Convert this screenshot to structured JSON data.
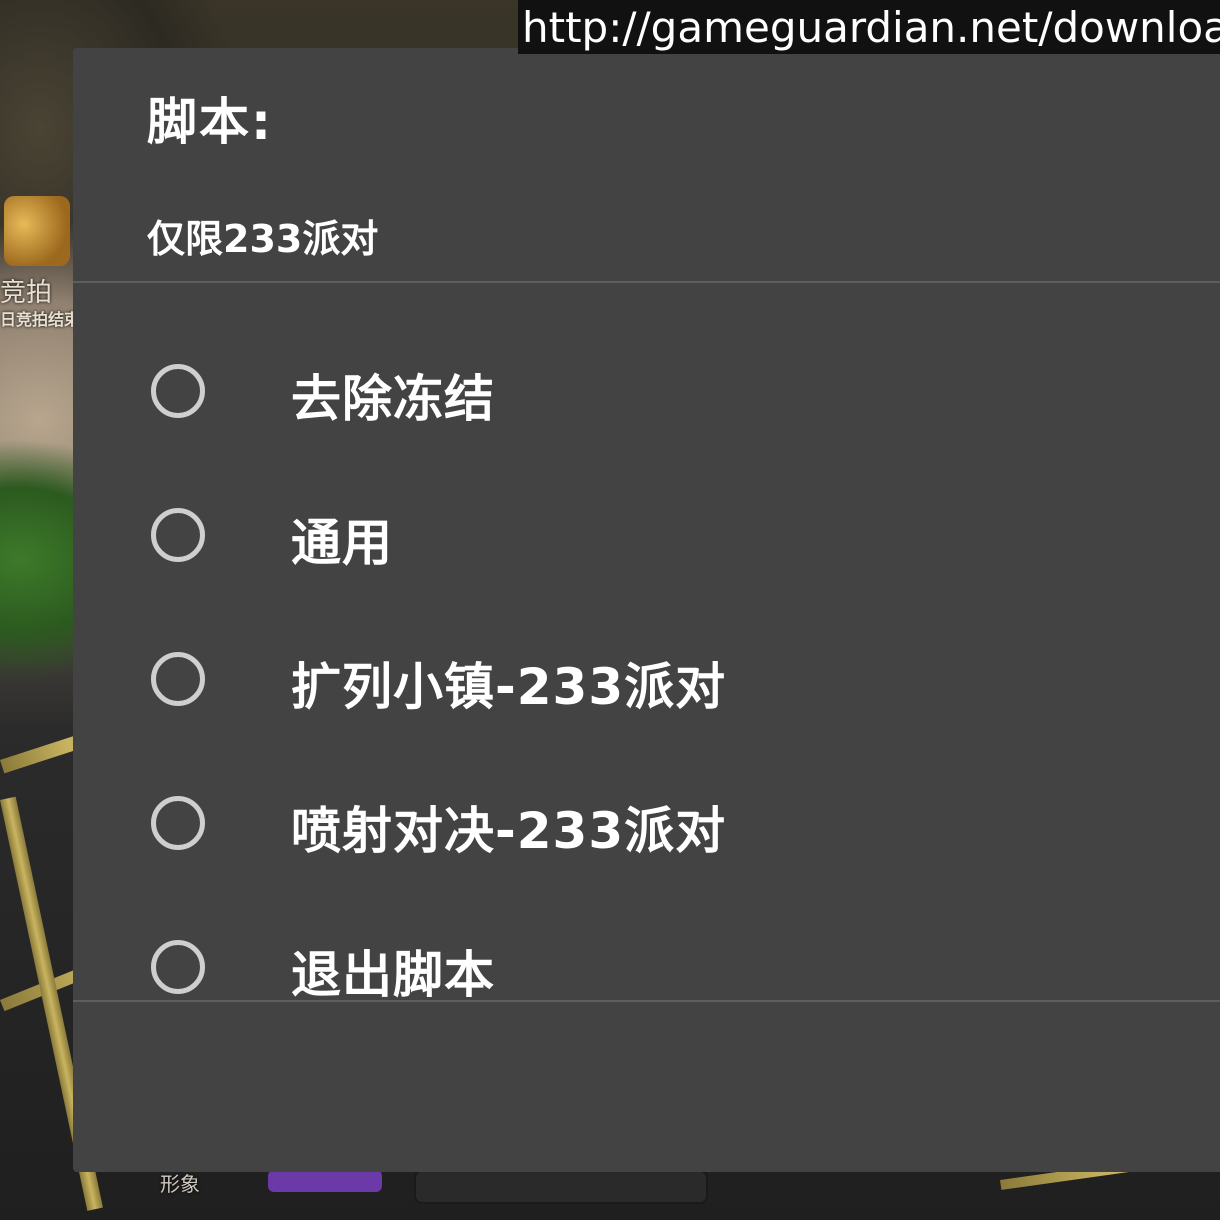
{
  "url_banner": "http://gameguardian.net/download",
  "background": {
    "auction_label": "竞拍",
    "auction_ended_label": "日竞拍结束",
    "shape_label": "形象"
  },
  "dialog": {
    "title": "脚本:",
    "subtitle": "仅限233派对",
    "options": [
      {
        "label": "去除冻结",
        "selected": false
      },
      {
        "label": "通用",
        "selected": false
      },
      {
        "label": "扩列小镇-233派对",
        "selected": false
      },
      {
        "label": "喷射对决-233派对",
        "selected": false
      },
      {
        "label": "退出脚本",
        "selected": false
      }
    ]
  },
  "colors": {
    "dialog_background": "#434343",
    "radio_ring": "#cfcfcf",
    "text": "#ffffff"
  }
}
